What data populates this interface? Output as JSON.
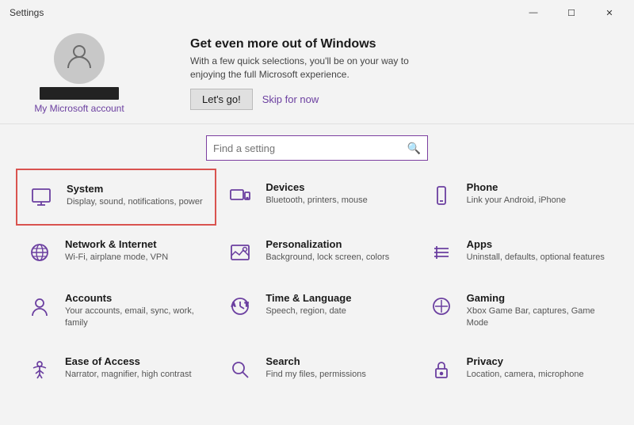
{
  "titlebar": {
    "title": "Settings",
    "minimize": "—",
    "maximize": "☐",
    "close": "✕"
  },
  "header": {
    "ms_account_label": "My Microsoft account",
    "promo_title": "Get even more out of Windows",
    "promo_desc": "With a few quick selections, you'll be on your way to enjoying the full Microsoft experience.",
    "btn_letsgo": "Let's go!",
    "btn_skip": "Skip for now"
  },
  "search": {
    "placeholder": "Find a setting"
  },
  "settings": [
    {
      "id": "system",
      "title": "System",
      "desc": "Display, sound, notifications, power",
      "highlighted": true
    },
    {
      "id": "devices",
      "title": "Devices",
      "desc": "Bluetooth, printers, mouse",
      "highlighted": false
    },
    {
      "id": "phone",
      "title": "Phone",
      "desc": "Link your Android, iPhone",
      "highlighted": false
    },
    {
      "id": "network",
      "title": "Network & Internet",
      "desc": "Wi-Fi, airplane mode, VPN",
      "highlighted": false
    },
    {
      "id": "personalization",
      "title": "Personalization",
      "desc": "Background, lock screen, colors",
      "highlighted": false
    },
    {
      "id": "apps",
      "title": "Apps",
      "desc": "Uninstall, defaults, optional features",
      "highlighted": false
    },
    {
      "id": "accounts",
      "title": "Accounts",
      "desc": "Your accounts, email, sync, work, family",
      "highlighted": false
    },
    {
      "id": "time",
      "title": "Time & Language",
      "desc": "Speech, region, date",
      "highlighted": false
    },
    {
      "id": "gaming",
      "title": "Gaming",
      "desc": "Xbox Game Bar, captures, Game Mode",
      "highlighted": false
    },
    {
      "id": "ease",
      "title": "Ease of Access",
      "desc": "Narrator, magnifier, high contrast",
      "highlighted": false
    },
    {
      "id": "search",
      "title": "Search",
      "desc": "Find my files, permissions",
      "highlighted": false
    },
    {
      "id": "privacy",
      "title": "Privacy",
      "desc": "Location, camera, microphone",
      "highlighted": false
    }
  ]
}
